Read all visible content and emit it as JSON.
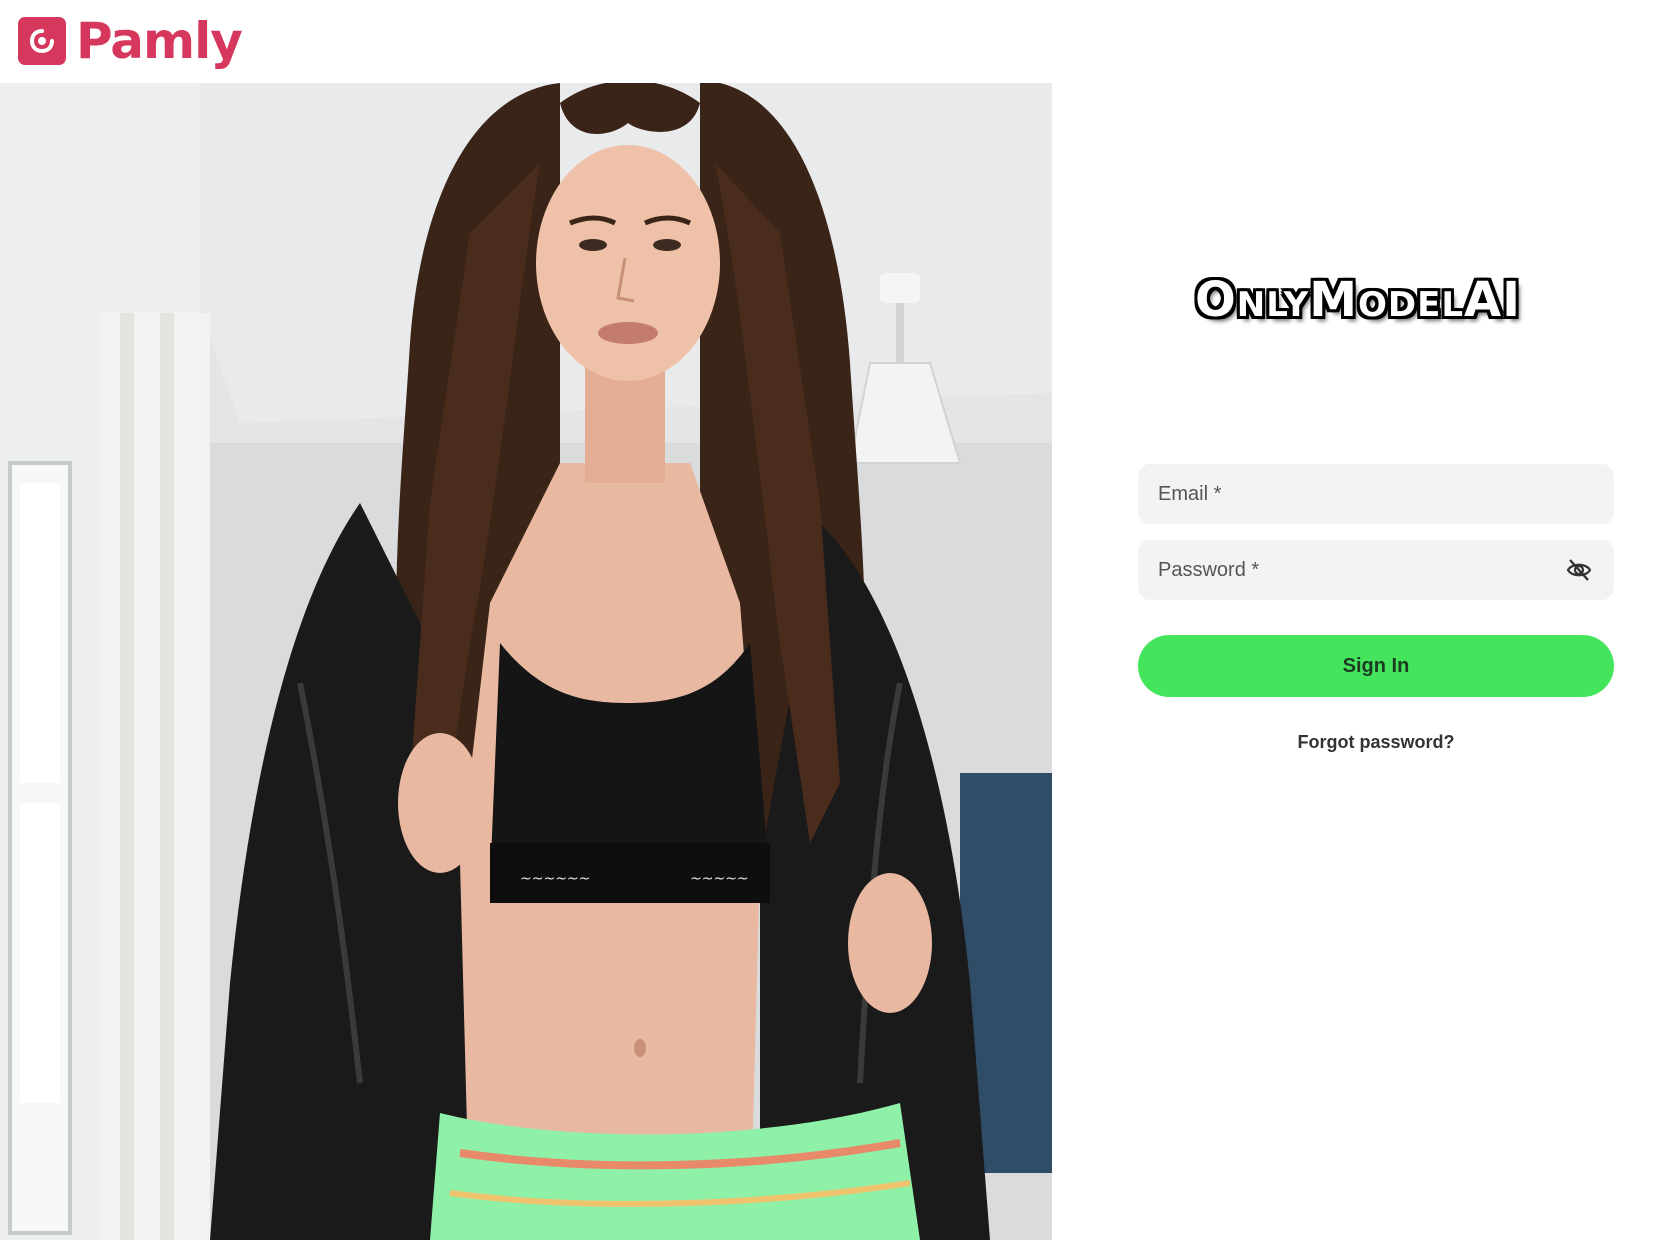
{
  "brand": {
    "name": "Pamly",
    "logo_icon": "pamly-logo-icon",
    "color": "#d6375c"
  },
  "hero": {
    "icon_avatar": "user-avatar-icon"
  },
  "login": {
    "watermark_title": "OnlyModelAI",
    "email_placeholder": "Email *",
    "password_placeholder": "Password *",
    "password_toggle_icon": "eye-slash-icon",
    "signin_label": "Sign In",
    "forgot_label": "Forgot password?",
    "accent_color": "#44e55c"
  }
}
